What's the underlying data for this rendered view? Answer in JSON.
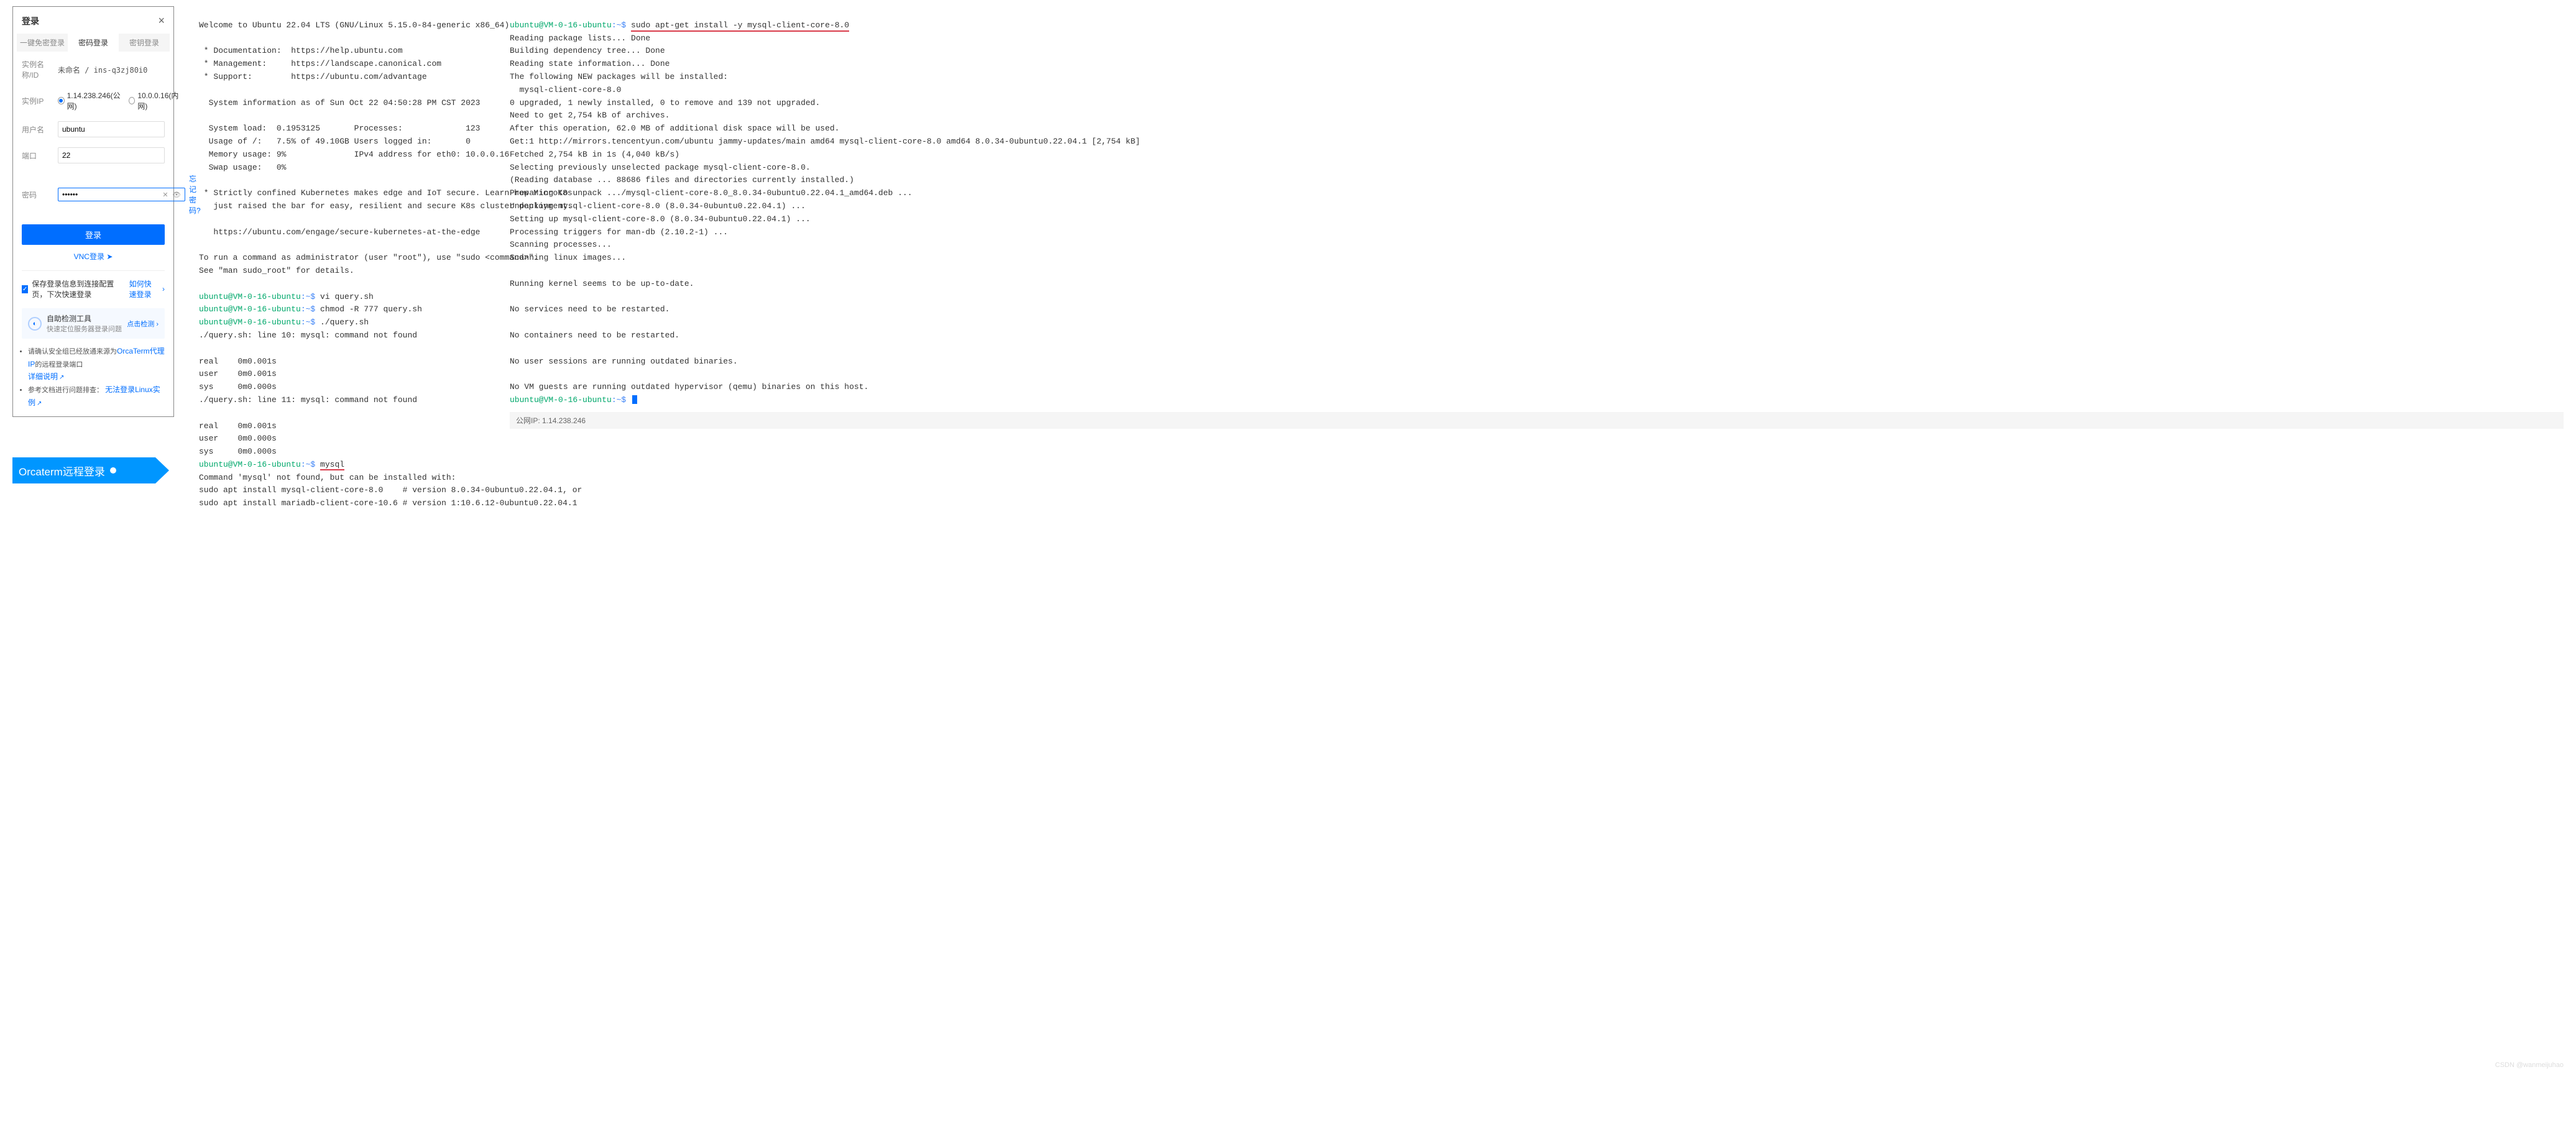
{
  "login": {
    "title": "登录",
    "tabs": {
      "t1": "一键免密登录",
      "t2": "密码登录",
      "t3": "密钥登录"
    },
    "fields": {
      "instance_label": "实例名称/ID",
      "instance_value": "未命名 / ins-q3zj80i0",
      "ip_label": "实例IP",
      "ip_public": "1.14.238.246(公网)",
      "ip_private": "10.0.0.16(内网)",
      "user_label": "用户名",
      "user_value": "ubuntu",
      "port_label": "端口",
      "port_value": "22",
      "pwd_label": "密码",
      "pwd_value": "••••••",
      "forgot": "忘记密码?"
    },
    "login_btn": "登录",
    "vnc": "VNC登录",
    "remember": "保存登录信息到连接配置页，下次快速登录",
    "quick": "如何快速登录",
    "detect": {
      "title": "自助检测工具",
      "sub": "快速定位服务器登录问题",
      "action": "点击检测"
    },
    "bullets": {
      "b1a": "请确认安全组已经放通来源为",
      "b1b": "OrcaTerm代理IP",
      "b1c": "的远程登录端口",
      "b1d": "详细说明",
      "b2a": "参考文档进行问题排查：",
      "b2b": "无法登录Linux实例"
    }
  },
  "badge": {
    "text": "Orcaterm远程登录"
  },
  "term_mid": {
    "welcome": "Welcome to Ubuntu 22.04 LTS (GNU/Linux 5.15.0-84-generic x86_64)",
    "doc": " * Documentation:  https://help.ubuntu.com",
    "mgmt": " * Management:     https://landscape.canonical.com",
    "sup": " * Support:        https://ubuntu.com/advantage",
    "sysinfo_hdr": "  System information as of Sun Oct 22 04:50:28 PM CST 2023",
    "s1": "  System load:  0.1953125       Processes:             123",
    "s2": "  Usage of /:   7.5% of 49.10GB Users logged in:       0",
    "s3": "  Memory usage: 9%              IPv4 address for eth0: 10.0.0.16",
    "s4": "  Swap usage:   0%",
    "k8s1": " * Strictly confined Kubernetes makes edge and IoT secure. Learn how MicroK8s",
    "k8s2": "   just raised the bar for easy, resilient and secure K8s cluster deployment.",
    "k8s3": "   https://ubuntu.com/engage/secure-kubernetes-at-the-edge",
    "sudo1": "To run a command as administrator (user \"root\"), use \"sudo <command>\".",
    "sudo2": "See \"man sudo_root\" for details.",
    "p": "ubuntu@VM-0-16-ubuntu",
    "tilde": ":~$ ",
    "c1": "vi query.sh",
    "c2": "chmod -R 777 query.sh",
    "c3": "./query.sh",
    "e1": "./query.sh: line 10: mysql: command not found",
    "t1": "real    0m0.001s",
    "t2": "user    0m0.001s",
    "t3": "sys     0m0.000s",
    "e2": "./query.sh: line 11: mysql: command not found",
    "t4": "real    0m0.001s",
    "t5": "user    0m0.000s",
    "t6": "sys     0m0.000s",
    "c4": "mysql",
    "nf1": "Command 'mysql' not found, but can be installed with:",
    "nf2": "sudo apt install mysql-client-core-8.0    # version 8.0.34-0ubuntu0.22.04.1, or",
    "nf3": "sudo apt install mariadb-client-core-10.6 # version 1:10.6.12-0ubuntu0.22.04.1"
  },
  "term_right": {
    "cmd": "sudo apt-get install -y mysql-client-core-8.0",
    "l1": "Reading package lists... Done",
    "l2": "Building dependency tree... Done",
    "l3": "Reading state information... Done",
    "l4": "The following NEW packages will be installed:",
    "l5": "  mysql-client-core-8.0",
    "l6": "0 upgraded, 1 newly installed, 0 to remove and 139 not upgraded.",
    "l7": "Need to get 2,754 kB of archives.",
    "l8": "After this operation, 62.0 MB of additional disk space will be used.",
    "l9": "Get:1 http://mirrors.tencentyun.com/ubuntu jammy-updates/main amd64 mysql-client-core-8.0 amd64 8.0.34-0ubuntu0.22.04.1 [2,754 kB]",
    "l10": "Fetched 2,754 kB in 1s (4,040 kB/s)",
    "l11": "Selecting previously unselected package mysql-client-core-8.0.",
    "l12": "(Reading database ... 88686 files and directories currently installed.)",
    "l13": "Preparing to unpack .../mysql-client-core-8.0_8.0.34-0ubuntu0.22.04.1_amd64.deb ...",
    "l14": "Unpacking mysql-client-core-8.0 (8.0.34-0ubuntu0.22.04.1) ...",
    "l15": "Setting up mysql-client-core-8.0 (8.0.34-0ubuntu0.22.04.1) ...",
    "l16": "Processing triggers for man-db (2.10.2-1) ...",
    "l17": "Scanning processes...",
    "l18": "Scanning linux images...",
    "l19": "Running kernel seems to be up-to-date.",
    "l20": "No services need to be restarted.",
    "l21": "No containers need to be restarted.",
    "l22": "No user sessions are running outdated binaries.",
    "l23": "No VM guests are running outdated hypervisor (qemu) binaries on this host.",
    "status": "公网IP: 1.14.238.246"
  },
  "watermark": "CSDN @wanmeijuhao"
}
